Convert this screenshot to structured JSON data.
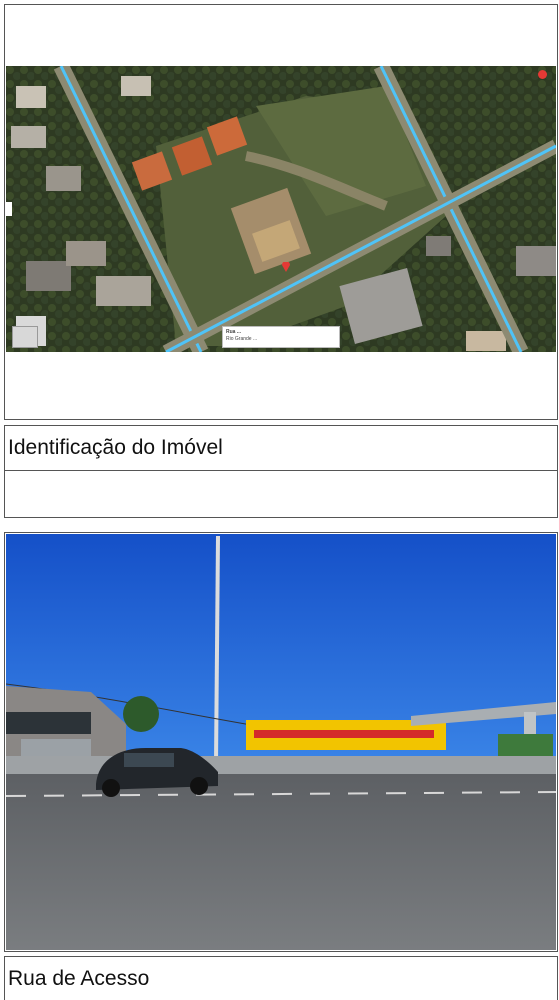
{
  "sections": [
    {
      "image": {
        "kind": "satellite-map",
        "marker_icon": "map-pin-icon",
        "popup_lines": [
          "Rua ...",
          "Rio Grande ..."
        ]
      },
      "caption": "Identificação do Imóvel"
    },
    {
      "image": {
        "kind": "street-photo"
      },
      "caption": "Rua de Acesso"
    }
  ],
  "colors": {
    "border": "#555555",
    "road_highlight": "#4fc3f7",
    "sky": "#1a5fd6",
    "asphalt": "#6b6e72"
  }
}
